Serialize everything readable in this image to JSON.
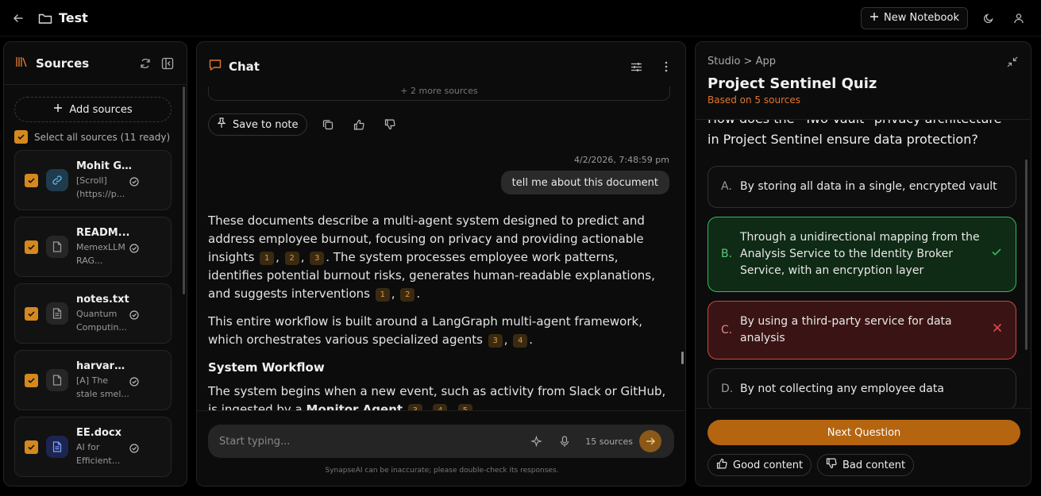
{
  "header": {
    "title": "Test",
    "new_notebook_label": "New Notebook"
  },
  "sources": {
    "title": "Sources",
    "add_label": "Add sources",
    "select_all_label": "Select all sources (11 ready)",
    "items": [
      {
        "name": "Mohit G...",
        "line1": "[Scroll]",
        "line2": "(https://p...",
        "icon": "link-icon"
      },
      {
        "name": "READM...",
        "line1": "MemexLLM",
        "line2": "RAG...",
        "icon": "file-icon"
      },
      {
        "name": "notes.txt",
        "line1": "Quantum",
        "line2": "Computin...",
        "icon": "text-file-icon"
      },
      {
        "name": "harvard....",
        "line1": "[A] The",
        "line2": "stale smel...",
        "icon": "file-icon"
      },
      {
        "name": "EE.docx",
        "line1": "AI for",
        "line2": "Efficient...",
        "icon": "doc-file-icon"
      }
    ]
  },
  "chat": {
    "title": "Chat",
    "more_sources": "+ 2 more sources",
    "save_to_note": "Save to note",
    "timestamp": "4/2/2026, 7:48:59 pm",
    "user_message": "tell me about this document",
    "p1_a": "These documents describe a multi-agent system designed to predict and address employee burnout, focusing on privacy and providing actionable insights",
    "p1_b": ". The system processes employee work patterns, identifies potential burnout risks, generates human-readable explanations, and suggests interventions",
    "p2_a": "This entire workflow is built around a LangGraph multi-agent framework, which orchestrates various specialized agents",
    "heading": "System Workflow",
    "p3_a": "The system begins when a new event, such as activity from Slack or GitHub, is ingested by a",
    "p3_bold": "Monitor Agent",
    "cites": [
      "1",
      "2",
      "3",
      "4",
      "5"
    ],
    "input_placeholder": "Start typing...",
    "source_count": "15 sources",
    "disclaimer": "SynapseAI can be inaccurate; please double-check its responses."
  },
  "studio": {
    "breadcrumb": "Studio > App",
    "title": "Project Sentinel Quiz",
    "based_on": "Based on 5 sources",
    "question": "How does the \"Two-Vault\" privacy architecture in Project Sentinel ensure data protection?",
    "options": [
      {
        "letter": "A.",
        "text": "By storing all data in a single, encrypted vault",
        "state": "neutral"
      },
      {
        "letter": "B.",
        "text": "Through a unidirectional mapping from the Analysis Service to the Identity Broker Service, with an encryption layer",
        "state": "correct"
      },
      {
        "letter": "C.",
        "text": "By using a third-party service for data analysis",
        "state": "wrong"
      },
      {
        "letter": "D.",
        "text": "By not collecting any employee data",
        "state": "neutral"
      }
    ],
    "next_label": "Next Question",
    "good_label": "Good content",
    "bad_label": "Bad content"
  },
  "colors": {
    "accent": "#d4881e",
    "correct": "#2fbf5a",
    "wrong": "#d04545",
    "citation": "#e09a3c"
  }
}
